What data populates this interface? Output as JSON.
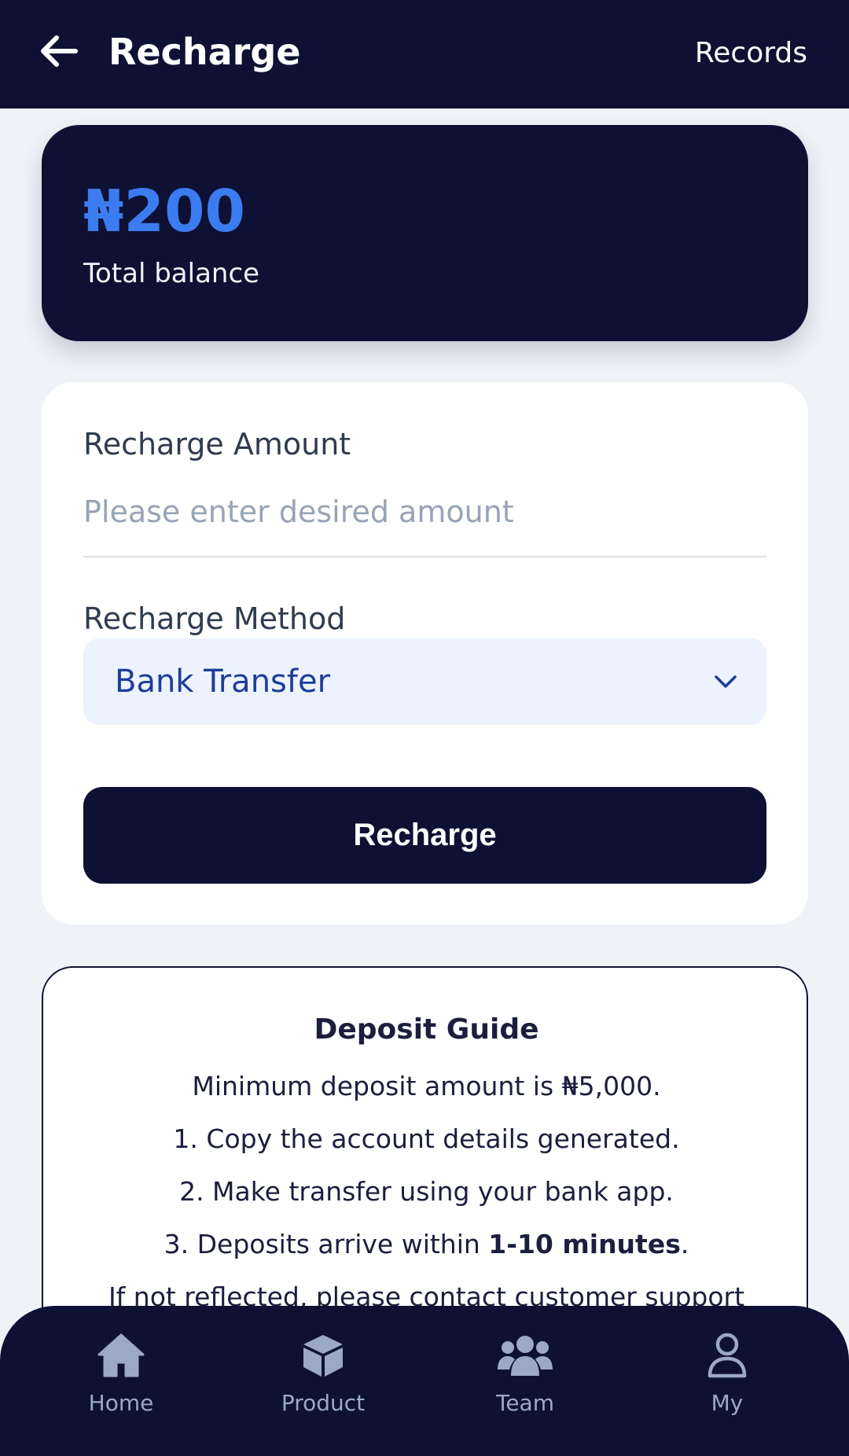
{
  "header": {
    "title": "Recharge",
    "records_label": "Records",
    "back_icon": "arrow-left-icon"
  },
  "balance": {
    "amount": "₦200",
    "label": "Total balance"
  },
  "form": {
    "amount_label": "Recharge Amount",
    "amount_placeholder": "Please enter desired amount",
    "amount_value": "",
    "method_label": "Recharge Method",
    "method_selected": "Bank Transfer",
    "submit_label": "Recharge"
  },
  "guide": {
    "title": "Deposit Guide",
    "line1": "Minimum deposit amount is ₦5,000.",
    "line2": "1. Copy the account details generated.",
    "line3": "2. Make transfer using your bank app.",
    "line4_prefix": "3. Deposits arrive within ",
    "line4_bold": "1-10 minutes",
    "line4_suffix": ".",
    "line5": "If not reflected, please contact customer support"
  },
  "nav": {
    "items": [
      {
        "label": "Home",
        "icon": "home-icon"
      },
      {
        "label": "Product",
        "icon": "cube-icon"
      },
      {
        "label": "Team",
        "icon": "team-icon"
      },
      {
        "label": "My",
        "icon": "user-icon"
      }
    ]
  },
  "colors": {
    "navy": "#0e1133",
    "accent_blue": "#3b7cf1",
    "select_bg": "#ecf3fe",
    "select_text": "#1f3c9a",
    "nav_inactive": "#9ba9c6",
    "page_bg": "#eff3f8"
  }
}
